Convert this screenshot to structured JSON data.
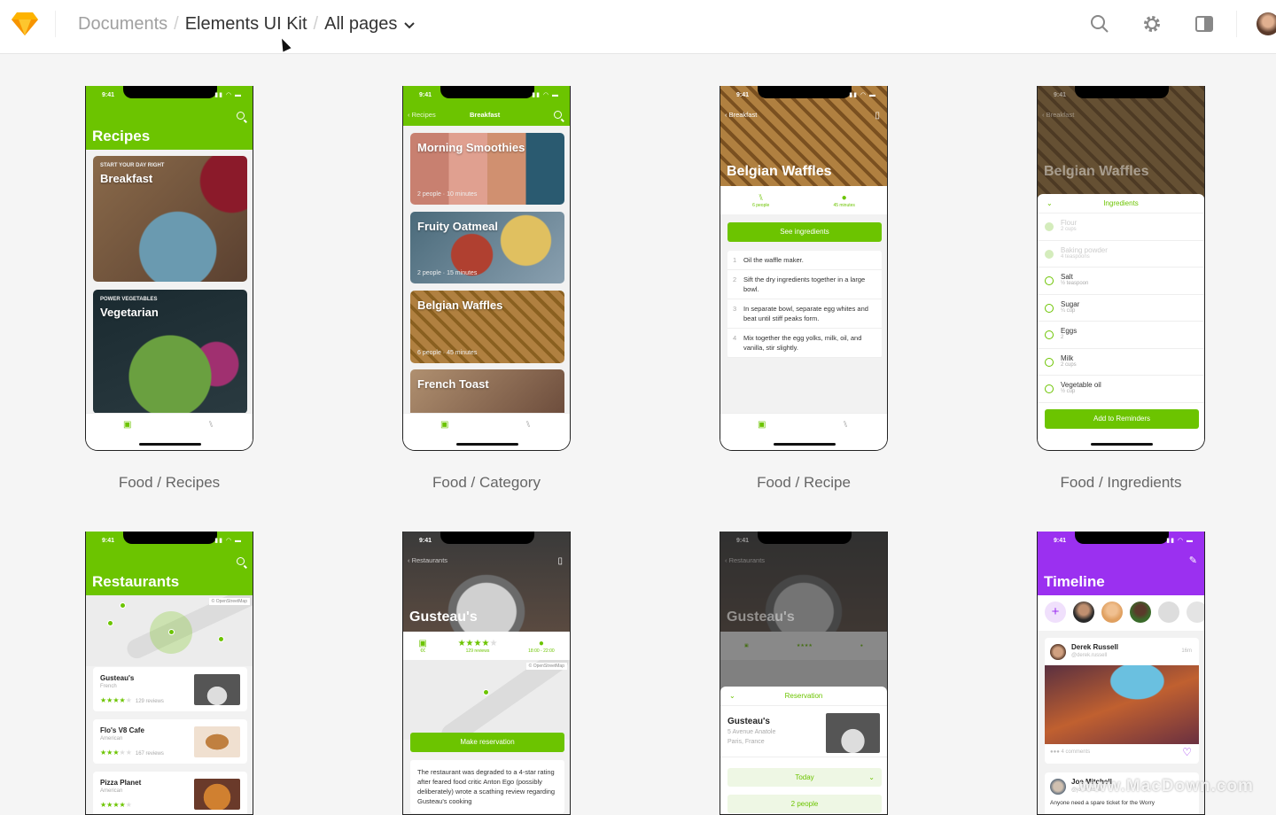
{
  "topbar": {
    "breadcrumb": [
      "Documents",
      "Elements UI Kit",
      "All pages"
    ],
    "separator": "/",
    "icons": [
      "sketch-logo",
      "search-icon",
      "gear-icon",
      "sidebar-toggle-icon",
      "user-avatar"
    ]
  },
  "colors": {
    "accent_green": "#6cc400",
    "accent_purple": "#9b30f0"
  },
  "status_time": "9:41",
  "artboards": [
    {
      "label": "Food / Recipes",
      "title": "Recipes",
      "cards": [
        {
          "kicker": "START YOUR DAY RIGHT",
          "title": "Breakfast"
        },
        {
          "kicker": "POWER VEGETABLES",
          "title": "Vegetarian"
        }
      ]
    },
    {
      "label": "Food / Category",
      "back": "Recipes",
      "title": "Breakfast",
      "cards": [
        {
          "title": "Morning Smoothies",
          "meta": "2 people · 10 minutes"
        },
        {
          "title": "Fruity Oatmeal",
          "meta": "2 people · 15 minutes"
        },
        {
          "title": "Belgian Waffles",
          "meta": "6 people · 45 minutes"
        },
        {
          "title": "French Toast"
        }
      ]
    },
    {
      "label": "Food / Recipe",
      "back": "Breakfast",
      "title": "Belgian Waffles",
      "people": "6 people",
      "time": "45 minutes",
      "button": "See ingredients",
      "steps": [
        {
          "n": "1",
          "text": "Oil the waffle maker."
        },
        {
          "n": "2",
          "text": "Sift the dry ingredients together in a large bowl."
        },
        {
          "n": "3",
          "text": "In separate bowl, separate egg whites and beat until stiff peaks form."
        },
        {
          "n": "4",
          "text": "Mix together the egg yolks, milk, oil, and vanilla, stir slightly."
        }
      ]
    },
    {
      "label": "Food / Ingredients",
      "back": "Breakfast",
      "title": "Belgian Waffles",
      "sheet_title": "Ingredients",
      "button": "Add to Reminders",
      "ingredients": [
        {
          "name": "Flour",
          "qty": "2 cups",
          "checked": true
        },
        {
          "name": "Baking powder",
          "qty": "4 teaspoons",
          "checked": true
        },
        {
          "name": "Salt",
          "qty": "½ teaspoon"
        },
        {
          "name": "Sugar",
          "qty": "¼ cup"
        },
        {
          "name": "Eggs",
          "qty": "2"
        },
        {
          "name": "Milk",
          "qty": "2 cups"
        },
        {
          "name": "Vegetable oil",
          "qty": "½ cup"
        }
      ]
    },
    {
      "title": "Restaurants",
      "map_credit": "© OpenStreetMap",
      "restaurants": [
        {
          "name": "Gusteau's",
          "cuisine": "French",
          "rating": 4,
          "reviews": "129 reviews"
        },
        {
          "name": "Flo's V8 Cafe",
          "cuisine": "American",
          "rating": 3,
          "reviews": "167 reviews"
        },
        {
          "name": "Pizza Planet",
          "cuisine": "American",
          "rating": 4
        }
      ]
    },
    {
      "back": "Restaurants",
      "title": "Gusteau's",
      "price": "€€",
      "reviews": "129 reviews",
      "rating": 4,
      "hours": "18:00 - 22:00",
      "map_credit": "© OpenStreetMap",
      "button": "Make reservation",
      "description": "The restaurant was degraded to a 4-star rating after feared food critic Anton Ego (possibly deliberately) wrote a scathing review regarding Gusteau's cooking"
    },
    {
      "back": "Restaurants",
      "title": "Gusteau's",
      "sheet_title": "Reservation",
      "name": "Gusteau's",
      "address1": "5 Avenue Anatole",
      "address2": "Paris, France",
      "date": "Today",
      "guests": "2 people"
    },
    {
      "title": "Timeline",
      "posts": [
        {
          "name": "Derek Russell",
          "handle": "@derek.russell",
          "time": "16m",
          "comments": "4 comments"
        },
        {
          "name": "Joe Mitchell",
          "handle": "@joe.mitchell",
          "text": "Anyone need a spare ticket for the Worry"
        }
      ]
    }
  ],
  "watermark": "www.MacDown.com"
}
